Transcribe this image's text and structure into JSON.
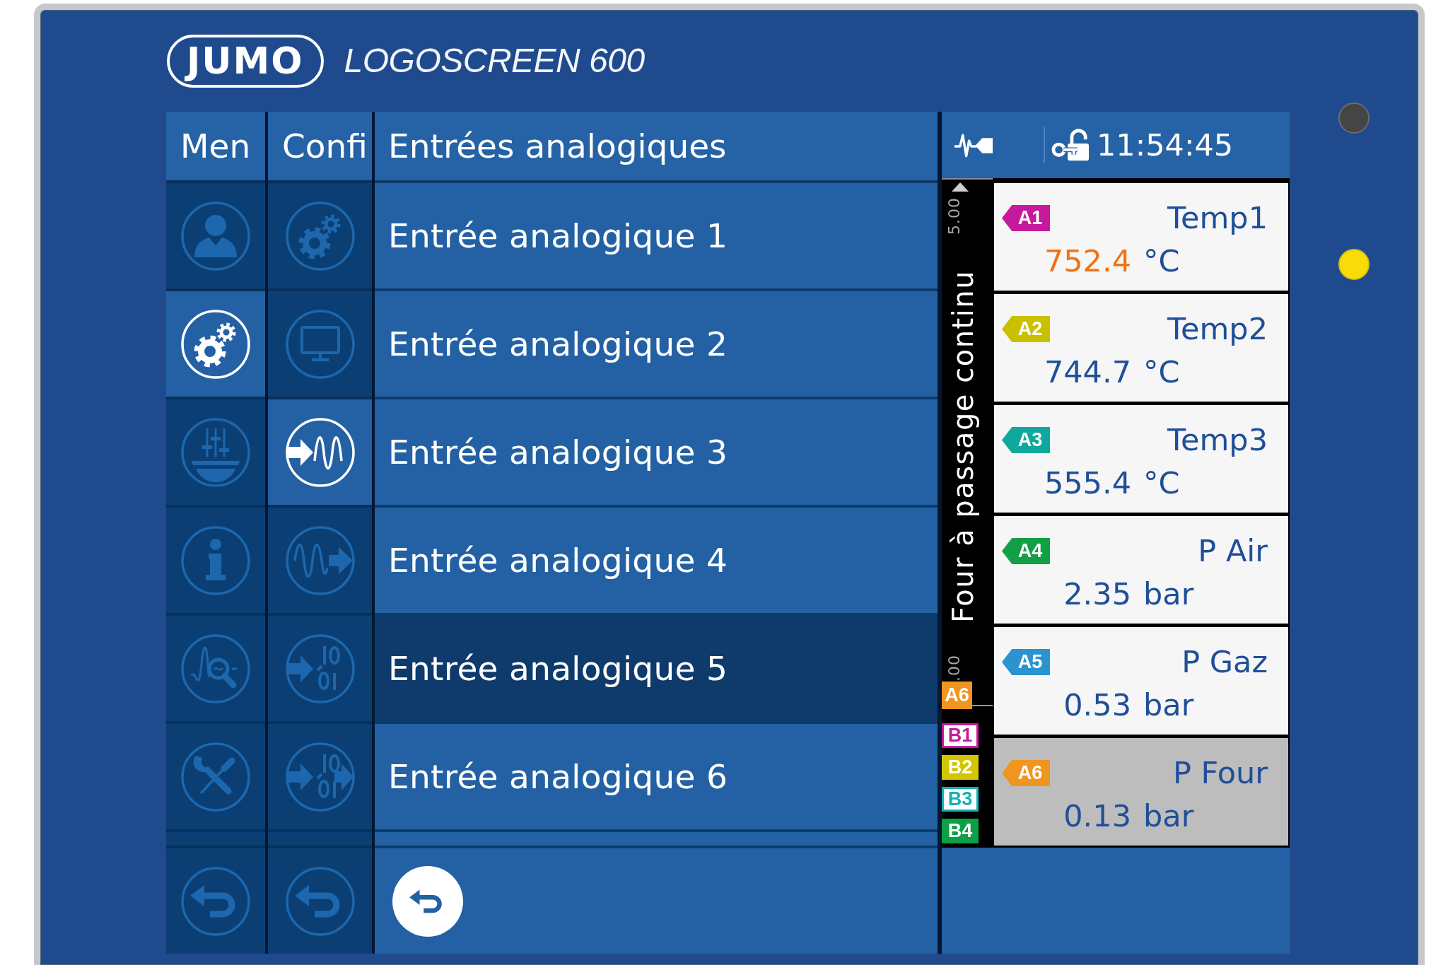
{
  "device": {
    "brand": "JUMO",
    "model": "LOGOSCREEN 600"
  },
  "status_leds": [
    {
      "on": false
    },
    {
      "on": true
    }
  ],
  "menu": {
    "title": "Men",
    "items": [
      {
        "kind": "user",
        "selected": false
      },
      {
        "kind": "configuration",
        "selected": true
      },
      {
        "kind": "parameters",
        "selected": false
      },
      {
        "kind": "info",
        "selected": false
      },
      {
        "kind": "evaluation",
        "selected": false
      },
      {
        "kind": "service",
        "selected": false
      }
    ]
  },
  "config": {
    "title": "Confi",
    "items": [
      {
        "kind": "general",
        "selected": false
      },
      {
        "kind": "display",
        "selected": false
      },
      {
        "kind": "analogin",
        "selected": true
      },
      {
        "kind": "analogout",
        "selected": false
      },
      {
        "kind": "digitalin",
        "selected": false
      },
      {
        "kind": "digitalout",
        "selected": false
      }
    ]
  },
  "list": {
    "title": "Entrées analogiques",
    "items": [
      {
        "label": "Entrée analogique 1",
        "selected": false
      },
      {
        "label": "Entrée analogique 2",
        "selected": false
      },
      {
        "label": "Entrée analogique 3",
        "selected": false
      },
      {
        "label": "Entrée analogique 4",
        "selected": false
      },
      {
        "label": "Entrée analogique 5",
        "selected": true
      },
      {
        "label": "Entrée analogique 6",
        "selected": false
      }
    ]
  },
  "status_bar": {
    "time": "11:54:45"
  },
  "scale": {
    "upper": "5.00",
    "title": "Four à passage continu",
    "lower": ".00",
    "tag": {
      "label": "A6",
      "color": "#f0951f"
    }
  },
  "binary_tags": [
    {
      "label": "B1",
      "color": "#c81a9a",
      "on": false
    },
    {
      "label": "B2",
      "color": "#d2c600",
      "on": true
    },
    {
      "label": "B3",
      "color": "#14b2b2",
      "on": false
    },
    {
      "label": "B4",
      "color": "#0aa046",
      "on": true
    }
  ],
  "channels": [
    {
      "tag": "A1",
      "color": "#c41a9b",
      "name": "Temp1",
      "value": "752.4",
      "unit": "°C",
      "alarm": true,
      "selected": false
    },
    {
      "tag": "A2",
      "color": "#c9c000",
      "name": "Temp2",
      "value": "744.7",
      "unit": "°C",
      "alarm": false,
      "selected": false
    },
    {
      "tag": "A3",
      "color": "#0fa89c",
      "name": "Temp3",
      "value": "555.4",
      "unit": "°C",
      "alarm": false,
      "selected": false
    },
    {
      "tag": "A4",
      "color": "#12a046",
      "name": "P Air",
      "value": "2.35",
      "unit": "bar",
      "alarm": false,
      "selected": false
    },
    {
      "tag": "A5",
      "color": "#2a93d0",
      "name": "P Gaz",
      "value": "0.53",
      "unit": "bar",
      "alarm": false,
      "selected": false
    },
    {
      "tag": "A6",
      "color": "#f0951f",
      "name": "P Four",
      "value": "0.13",
      "unit": "bar",
      "alarm": false,
      "selected": true
    }
  ]
}
